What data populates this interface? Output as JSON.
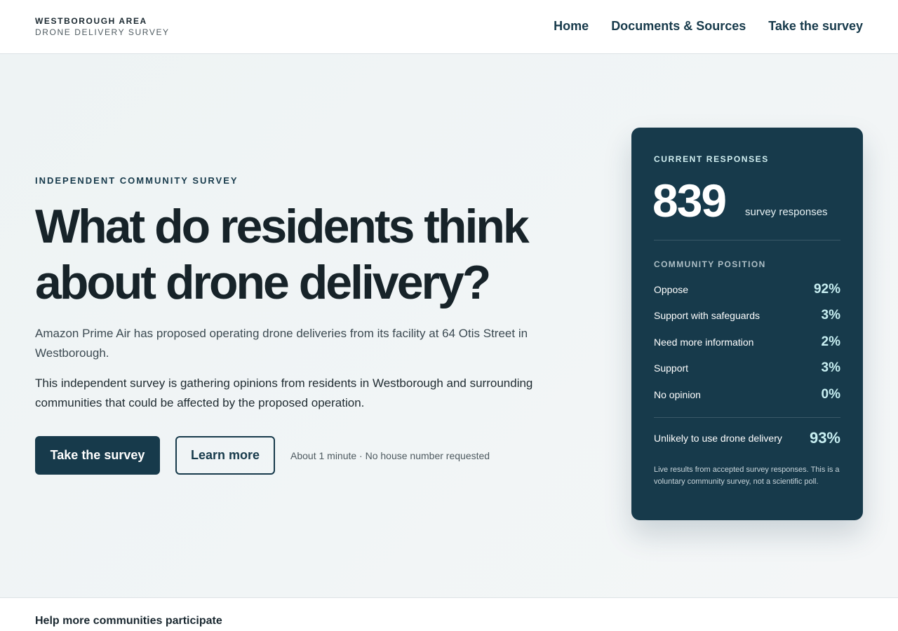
{
  "header": {
    "brand_line1": "WESTBOROUGH AREA",
    "brand_line2": "DRONE DELIVERY SURVEY",
    "nav": [
      {
        "label": "Home"
      },
      {
        "label": "Documents & Sources"
      },
      {
        "label": "Take the survey"
      }
    ]
  },
  "hero": {
    "eyebrow": "INDEPENDENT COMMUNITY SURVEY",
    "headline": "What do residents think about drone delivery?",
    "lead": "Amazon Prime Air has proposed operating drone deliveries from its facility at 64 Otis Street in Westborough.",
    "lead2": "This independent survey is gathering opinions from residents in Westborough and surrounding communities that could be affected by the proposed operation.",
    "primary_cta": "Take the survey",
    "secondary_cta": "Learn more",
    "cta_note": "About 1 minute · No house number requested"
  },
  "card": {
    "label": "CURRENT RESPONSES",
    "count": "839",
    "count_unit": "survey responses",
    "position_label": "COMMUNITY POSITION",
    "rows": [
      {
        "label": "Oppose",
        "value": "92%"
      },
      {
        "label": "Support with safeguards",
        "value": "3%"
      },
      {
        "label": "Need more information",
        "value": "2%"
      },
      {
        "label": "Support",
        "value": "3%"
      },
      {
        "label": "No opinion",
        "value": "0%"
      }
    ],
    "unlikely_label": "Unlikely to use drone delivery",
    "unlikely_value": "93%",
    "fineprint": "Live results from accepted survey responses. This is a voluntary community survey, not a scientific poll."
  },
  "footer": {
    "title": "Help more communities participate"
  },
  "colors": {
    "primary": "#173a4b",
    "accent_value": "#c8eff2",
    "hero_bg": "#eef3f4"
  }
}
